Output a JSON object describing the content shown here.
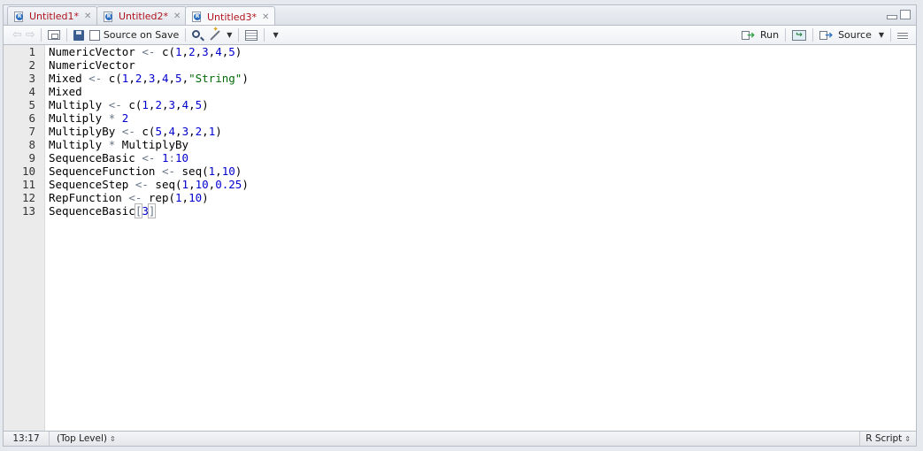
{
  "tabs": [
    {
      "label": "Untitled1*",
      "active": false
    },
    {
      "label": "Untitled2*",
      "active": false
    },
    {
      "label": "Untitled3*",
      "active": true
    }
  ],
  "toolbar": {
    "source_on_save_label": "Source on Save",
    "run_label": "Run",
    "source_label": "Source"
  },
  "editor": {
    "line_numbers": [
      "1",
      "2",
      "3",
      "4",
      "5",
      "6",
      "7",
      "8",
      "9",
      "10",
      "11",
      "12",
      "13"
    ],
    "lines": [
      [
        [
          "t",
          "NumericVector "
        ],
        [
          "o",
          "<-"
        ],
        [
          "t",
          " c("
        ],
        [
          "n",
          "1"
        ],
        [
          "t",
          ","
        ],
        [
          "n",
          "2"
        ],
        [
          "t",
          ","
        ],
        [
          "n",
          "3"
        ],
        [
          "t",
          ","
        ],
        [
          "n",
          "4"
        ],
        [
          "t",
          ","
        ],
        [
          "n",
          "5"
        ],
        [
          "t",
          ")"
        ]
      ],
      [
        [
          "t",
          "NumericVector"
        ]
      ],
      [
        [
          "t",
          "Mixed "
        ],
        [
          "o",
          "<-"
        ],
        [
          "t",
          " c("
        ],
        [
          "n",
          "1"
        ],
        [
          "t",
          ","
        ],
        [
          "n",
          "2"
        ],
        [
          "t",
          ","
        ],
        [
          "n",
          "3"
        ],
        [
          "t",
          ","
        ],
        [
          "n",
          "4"
        ],
        [
          "t",
          ","
        ],
        [
          "n",
          "5"
        ],
        [
          "t",
          ","
        ],
        [
          "s",
          "\"String\""
        ],
        [
          "t",
          ")"
        ]
      ],
      [
        [
          "t",
          "Mixed"
        ]
      ],
      [
        [
          "t",
          "Multiply "
        ],
        [
          "o",
          "<-"
        ],
        [
          "t",
          " c("
        ],
        [
          "n",
          "1"
        ],
        [
          "t",
          ","
        ],
        [
          "n",
          "2"
        ],
        [
          "t",
          ","
        ],
        [
          "n",
          "3"
        ],
        [
          "t",
          ","
        ],
        [
          "n",
          "4"
        ],
        [
          "t",
          ","
        ],
        [
          "n",
          "5"
        ],
        [
          "t",
          ")"
        ]
      ],
      [
        [
          "t",
          "Multiply "
        ],
        [
          "o",
          "*"
        ],
        [
          "t",
          " "
        ],
        [
          "n",
          "2"
        ]
      ],
      [
        [
          "t",
          "MultiplyBy "
        ],
        [
          "o",
          "<-"
        ],
        [
          "t",
          " c("
        ],
        [
          "n",
          "5"
        ],
        [
          "t",
          ","
        ],
        [
          "n",
          "4"
        ],
        [
          "t",
          ","
        ],
        [
          "n",
          "3"
        ],
        [
          "t",
          ","
        ],
        [
          "n",
          "2"
        ],
        [
          "t",
          ","
        ],
        [
          "n",
          "1"
        ],
        [
          "t",
          ")"
        ]
      ],
      [
        [
          "t",
          "Multiply "
        ],
        [
          "o",
          "*"
        ],
        [
          "t",
          " MultiplyBy"
        ]
      ],
      [
        [
          "t",
          "SequenceBasic "
        ],
        [
          "o",
          "<-"
        ],
        [
          "t",
          " "
        ],
        [
          "n",
          "1"
        ],
        [
          "o",
          ":"
        ],
        [
          "n",
          "10"
        ]
      ],
      [
        [
          "t",
          "SequenceFunction "
        ],
        [
          "o",
          "<-"
        ],
        [
          "t",
          " seq("
        ],
        [
          "n",
          "1"
        ],
        [
          "t",
          ","
        ],
        [
          "n",
          "10"
        ],
        [
          "t",
          ")"
        ]
      ],
      [
        [
          "t",
          "SequenceStep "
        ],
        [
          "o",
          "<-"
        ],
        [
          "t",
          " seq("
        ],
        [
          "n",
          "1"
        ],
        [
          "t",
          ","
        ],
        [
          "n",
          "10"
        ],
        [
          "t",
          ","
        ],
        [
          "n",
          "0.25"
        ],
        [
          "t",
          ")"
        ]
      ],
      [
        [
          "t",
          "RepFunction "
        ],
        [
          "o",
          "<-"
        ],
        [
          "t",
          " rep("
        ],
        [
          "n",
          "1"
        ],
        [
          "t",
          ","
        ],
        [
          "n",
          "10"
        ],
        [
          "t",
          ")"
        ]
      ],
      [
        [
          "t",
          "SequenceBasic"
        ],
        [
          "b",
          "["
        ],
        [
          "n",
          "3"
        ],
        [
          "b",
          "]"
        ]
      ]
    ]
  },
  "status": {
    "position": "13:17",
    "scope": "(Top Level)",
    "file_type": "R Script"
  },
  "colors": {
    "tab_label": "#b0141e",
    "number": "#0000cd",
    "string": "#036a07",
    "operator": "#687687"
  }
}
